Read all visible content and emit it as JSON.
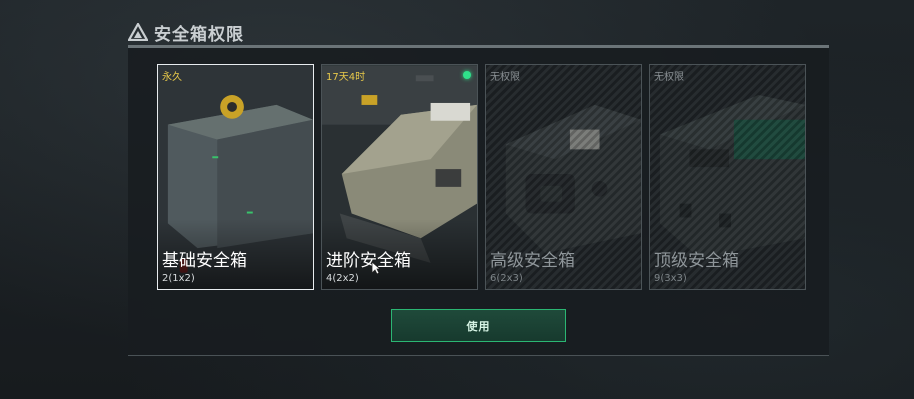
{
  "dialog": {
    "title": "安全箱权限",
    "icon": "triangle-warning-icon"
  },
  "cards": [
    {
      "tag": "永久",
      "name": "基础安全箱",
      "size": "2(1x2)",
      "status": "owned",
      "selected": true
    },
    {
      "tag": "17天4时",
      "name": "进阶安全箱",
      "size": "4(2x2)",
      "status": "active",
      "selected": false,
      "active_dot_color": "#2fe08a"
    },
    {
      "tag": "无权限",
      "name": "高级安全箱",
      "size": "6(2x3)",
      "status": "locked",
      "selected": false
    },
    {
      "tag": "无权限",
      "name": "顶级安全箱",
      "size": "9(3x3)",
      "status": "locked",
      "selected": false
    }
  ],
  "actions": {
    "use_label": "使用"
  },
  "colors": {
    "accent_green": "#2bb673",
    "tag_yellow": "#e8c94a",
    "selected_border": "#e8ecef"
  }
}
